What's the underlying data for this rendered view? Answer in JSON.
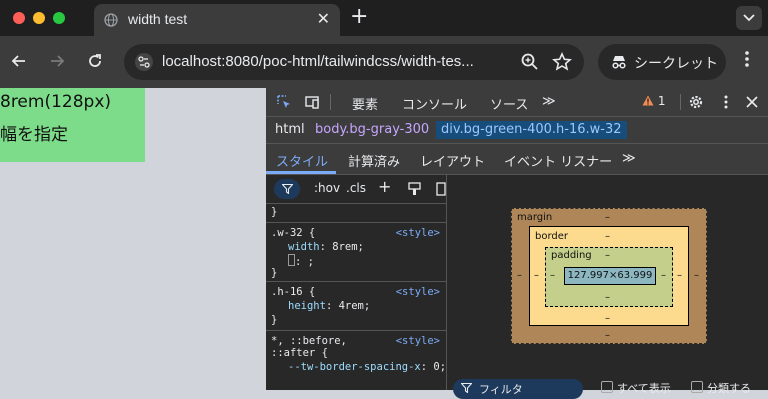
{
  "tab": {
    "title": "width test",
    "close": "✕",
    "new_tab": "+"
  },
  "address": {
    "url": "localhost:8080/poc-html/tailwindcss/width-tes..."
  },
  "incognito": {
    "label": "シークレット"
  },
  "page": {
    "line1": "8rem(128px)",
    "line2": "幅を指定"
  },
  "devtools": {
    "tabs": [
      "要素",
      "コンソール",
      "ソース",
      "≫"
    ],
    "warnings": "1",
    "breadcrumbs": [
      "html",
      "body.bg-gray-300",
      "div.bg-green-400.h-16.w-32"
    ],
    "subtabs": [
      "スタイル",
      "計算済み",
      "レイアウト",
      "イベント リスナー",
      "≫"
    ],
    "filter": {
      "hov": ":hov",
      "cls": ".cls"
    },
    "rules": [
      {
        "selector": "",
        "source": "",
        "props": [],
        "close": "}"
      },
      {
        "selector": ".w-32 {",
        "source": "<style>",
        "props": [
          {
            "name": "width",
            "value": "8rem;"
          },
          {
            "name": "",
            "value": ": ;"
          }
        ],
        "close": "}"
      },
      {
        "selector": ".h-16 {",
        "source": "<style>",
        "props": [
          {
            "name": "height",
            "value": "4rem;"
          }
        ],
        "close": "}"
      },
      {
        "selector": "*, ::before,",
        "selector2": "::after {",
        "source": "<style>",
        "props": [
          {
            "name": "--tw-border-spacing-x",
            "value": "0;"
          }
        ]
      }
    ],
    "boxmodel": {
      "margin_label": "margin",
      "border_label": "border",
      "padding_label": "padding",
      "content": "127.997×63.999",
      "dash": "–"
    },
    "bottom": {
      "filter": "フィルタ",
      "show_all": "すべて表示",
      "group": "分類する"
    }
  },
  "colors": {
    "green_box": "#7ddc8a",
    "page_bg": "#d1d5db",
    "accent": "#7cacf8"
  }
}
